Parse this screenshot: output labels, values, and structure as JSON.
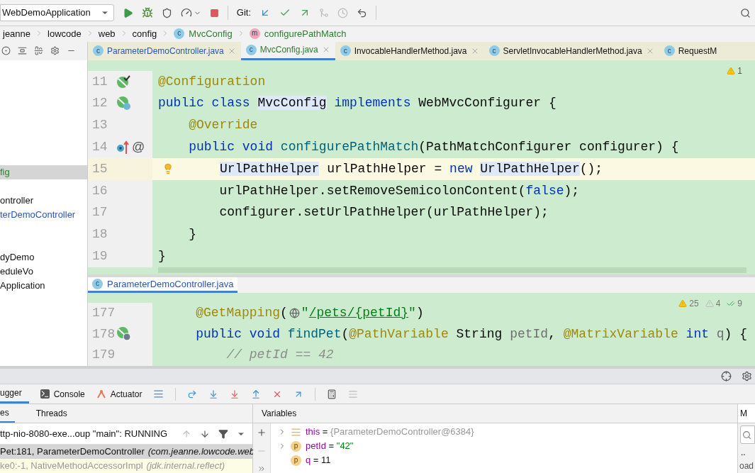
{
  "toolbar": {
    "run_config": "WebDemoApplication",
    "git_label": "Git:"
  },
  "breadcrumb": [
    {
      "text": "jeanne",
      "kind": "package"
    },
    {
      "text": "lowcode",
      "kind": "package"
    },
    {
      "text": "web",
      "kind": "package"
    },
    {
      "text": "config",
      "kind": "package"
    },
    {
      "text": "MvcConfig",
      "badge": "c",
      "kind": "class"
    },
    {
      "text": "configurePathMatch",
      "badge": "m",
      "kind": "method"
    }
  ],
  "editor_tabs": [
    {
      "label": "ParameterDemoController.java",
      "badge": "c",
      "selected": false,
      "modified": true
    },
    {
      "label": "MvcConfig.java",
      "badge": "c",
      "selected": true,
      "modified": false
    },
    {
      "label": "InvocableHandlerMethod.java",
      "badge": "c",
      "selected": false,
      "modified": false
    },
    {
      "label": "ServletInvocableHandlerMethod.java",
      "badge": "c",
      "selected": false,
      "modified": false
    },
    {
      "label": "RequestM",
      "badge": "c",
      "selected": false,
      "modified": false
    }
  ],
  "project_tree": [
    [
      {
        "text": "fig",
        "selected": true,
        "modified": false
      }
    ],
    [
      {
        "text": "ontroller",
        "selected": false,
        "modified": false
      },
      {
        "text": "terDemoController",
        "selected": false,
        "modified": true
      }
    ],
    [
      {
        "text": "dyDemo",
        "selected": false,
        "modified": false
      },
      {
        "text": "eduleVo",
        "selected": false,
        "modified": false
      },
      {
        "text": "Application",
        "selected": false,
        "modified": false
      }
    ]
  ],
  "editor_top": {
    "warnings": "1",
    "lines": [
      {
        "number": "11",
        "kind": "bean-check",
        "current": false,
        "tokens": [
          {
            "kind": "ann",
            "text": "@Configuration"
          }
        ]
      },
      {
        "number": "12",
        "kind": "bean-class",
        "current": false,
        "tokens": [
          {
            "kind": "kw",
            "text": "public class "
          },
          {
            "kind": "plain",
            "text": "MvcConfig",
            "hl": true
          },
          {
            "kind": "kw",
            "text": " implements "
          },
          {
            "kind": "plain",
            "text": "WebMvcConfigurer {"
          }
        ]
      },
      {
        "number": "13",
        "kind": "plain",
        "current": false,
        "tokens": [
          {
            "kind": "ann",
            "text": "    @Override"
          }
        ]
      },
      {
        "number": "14",
        "kind": "override",
        "gutter_text": "@",
        "current": false,
        "tokens": [
          {
            "kind": "kw",
            "text": "    public void "
          },
          {
            "kind": "fn",
            "text": "configurePathMatch"
          },
          {
            "kind": "plain",
            "text": "(PathMatchConfigurer configurer) {"
          }
        ]
      },
      {
        "number": "15",
        "kind": "plain",
        "current": true,
        "tokens": [
          {
            "kind": "plain",
            "text": "UrlPathHelper",
            "hl": true
          },
          {
            "kind": "plain",
            "text": " urlPathHelper = "
          },
          {
            "kind": "kw",
            "text": "new "
          },
          {
            "kind": "plain",
            "text": "UrlPathHelper",
            "hl": true
          },
          {
            "kind": "plain",
            "text": "();"
          }
        ]
      },
      {
        "number": "16",
        "kind": "plain",
        "current": false,
        "tokens": [
          {
            "kind": "plain",
            "text": "        urlPathHelper.setRemoveSemicolonContent("
          },
          {
            "kind": "kw",
            "text": "false"
          },
          {
            "kind": "plain",
            "text": ");"
          }
        ]
      },
      {
        "number": "17",
        "kind": "plain",
        "current": false,
        "tokens": [
          {
            "kind": "plain",
            "text": "        configurer.setUrlPathHelper(urlPathHelper);"
          }
        ]
      },
      {
        "number": "18",
        "kind": "plain",
        "current": false,
        "tokens": [
          {
            "kind": "plain",
            "text": "    }"
          }
        ]
      },
      {
        "number": "19",
        "kind": "plain",
        "current": false,
        "tokens": [
          {
            "kind": "plain",
            "text": "}"
          }
        ]
      }
    ]
  },
  "editor_bottom": {
    "tab": {
      "label": "ParameterDemoController.java",
      "badge": "c",
      "modified": true
    },
    "warnings": "25",
    "weak_warnings": "4",
    "typos": "9",
    "lines": [
      {
        "number": "177",
        "kind": "plain",
        "current": false,
        "tokens": [
          {
            "kind": "ann",
            "text": "    @GetMapping"
          },
          {
            "kind": "plain",
            "text": "("
          },
          {
            "kind": "globe"
          },
          {
            "kind": "str",
            "text": "\""
          },
          {
            "kind": "link",
            "text": "/pets/{petId}"
          },
          {
            "kind": "str",
            "text": "\""
          },
          {
            "kind": "plain",
            "text": ")"
          }
        ]
      },
      {
        "number": "178",
        "kind": "bean-web",
        "current": false,
        "tokens": [
          {
            "kind": "kw",
            "text": "    public void "
          },
          {
            "kind": "fn",
            "text": "findPet"
          },
          {
            "kind": "plain",
            "text": "("
          },
          {
            "kind": "ann",
            "text": "@PathVariable"
          },
          {
            "kind": "plain",
            "text": " String "
          },
          {
            "kind": "dim",
            "text": "petId"
          },
          {
            "kind": "plain",
            "text": ", "
          },
          {
            "kind": "ann",
            "text": "@MatrixVariable"
          },
          {
            "kind": "kw",
            "text": " int "
          },
          {
            "kind": "dim",
            "text": "q"
          },
          {
            "kind": "plain",
            "text": ") {"
          }
        ]
      },
      {
        "number": "179",
        "kind": "plain",
        "current": false,
        "tokens": [
          {
            "kind": "com",
            "text": "        // petId == 42"
          }
        ]
      }
    ]
  },
  "debug": {
    "tabs": [
      {
        "label": "ugger",
        "kind": "debugger",
        "selected": true
      },
      {
        "label": "Console",
        "kind": "console",
        "selected": false
      },
      {
        "label": "Actuator",
        "kind": "actuator",
        "selected": false
      }
    ],
    "subtabs": [
      {
        "label": "es",
        "selected": true
      },
      {
        "label": "Threads",
        "selected": false
      }
    ],
    "variables_title": "Variables",
    "thread": "ttp-nio-8080-exe...oup \"main\": RUNNING",
    "frames": [
      {
        "method": "Pet:181, ParameterDemoController",
        "package": "(com.jeanne.lowcode.web",
        "selected": true
      },
      {
        "method": "ke0:-1, NativeMethodAccessorImpl",
        "package": "(jdk.internal.reflect)",
        "selected": false
      }
    ],
    "variables": [
      {
        "name": "this",
        "sep": "=",
        "value": "{ParameterDemoController@6384}",
        "kind": "field",
        "expandable": true
      },
      {
        "name": "petId",
        "sep": "=",
        "value": "\"42\"",
        "kind": "param",
        "badge": "p",
        "expandable": true
      },
      {
        "name": "q",
        "sep": "=",
        "value": "11",
        "kind": "param",
        "badge": "p",
        "expandable": false
      }
    ],
    "side_tab": "M",
    "side_text": "oad",
    "side_dots": ".."
  }
}
